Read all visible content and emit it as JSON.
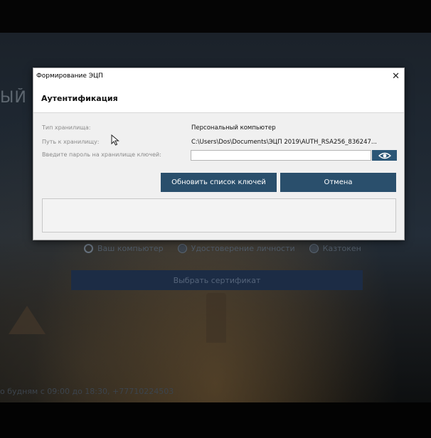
{
  "background": {
    "title_fragment": "ЫЙ К",
    "radio_options": [
      "Ваш компьютер",
      "Удостоверение личности",
      "Казтокен"
    ],
    "select_cert_label": "Выбрать сертификат",
    "footer_text": "о будням с 09:00 до 18:30, +77710224503"
  },
  "dialog": {
    "window_title": "Формирование ЭЦП",
    "close_glyph": "✕",
    "header_title": "Аутентификация",
    "storage_type_label": "Тип хранилища:",
    "storage_type_value": "Персональный компьютер",
    "storage_path_label": "Путь к хранилищу:",
    "storage_path_value": "C:\\Users\\Dos\\Documents\\ЭЦП 2019\\AUTH_RSA256_836247...",
    "password_label": "Введите пароль на хранилище ключей:",
    "password_value": "",
    "refresh_button_label": "Обновить список ключей",
    "cancel_button_label": "Отмена",
    "log_text": ""
  },
  "colors": {
    "button_bg": "#2a4f6c",
    "dialog_bg": "#f0f0f0"
  }
}
